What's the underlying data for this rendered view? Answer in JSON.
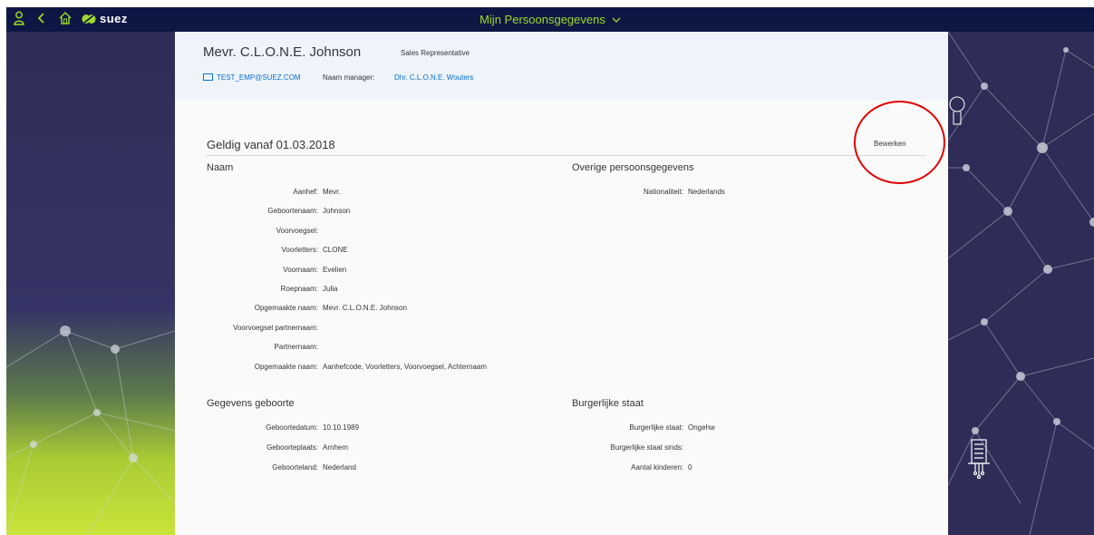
{
  "topbar": {
    "brand": "suez",
    "title": "Mijn Persoonsgegevens",
    "icons": [
      "user-icon",
      "back-icon",
      "home-icon",
      "chevron-down-icon"
    ]
  },
  "employee": {
    "name": "Mevr. C.L.O.N.E. Johnson",
    "role": "Sales Representative",
    "email": "TEST_EMP@SUEZ.COM",
    "manager_label": "Naam manager:",
    "manager_value": "Dhr. C.L.O.N.E. Wouters"
  },
  "record": {
    "valid_from": "Geldig vanaf 01.03.2018",
    "edit_label": "Bewerken"
  },
  "naam": {
    "title": "Naam",
    "fields": [
      {
        "label": "Aanhef:",
        "value": "Mevr."
      },
      {
        "label": "Geboortenaam:",
        "value": "Johnson"
      },
      {
        "label": "Voorvoegsel:",
        "value": ""
      },
      {
        "label": "Voorletters:",
        "value": "CLONE"
      },
      {
        "label": "Voornaam:",
        "value": "Evelien"
      },
      {
        "label": "Roepnaam:",
        "value": "Julia"
      },
      {
        "label": "Opgemaakte naam:",
        "value": "Mevr. C.L.O.N.E. Johnson"
      },
      {
        "label": "Voorvoegsel partnernaam:",
        "value": ""
      },
      {
        "label": "Partnernaam:",
        "value": ""
      },
      {
        "label": "Opgemaakte naam:",
        "value": "Aanhefcode, Voorletters, Voorvoegsel, Achternaam"
      }
    ]
  },
  "overige": {
    "title": "Overige persoonsgegevens",
    "fields": [
      {
        "label": "Nationaliteit:",
        "value": "Nederlands"
      }
    ]
  },
  "geboorte": {
    "title": "Gegevens geboorte",
    "fields": [
      {
        "label": "Geboortedatum:",
        "value": "10.10.1989"
      },
      {
        "label": "Geboorteplaats:",
        "value": "Arnhem"
      },
      {
        "label": "Geboorteland:",
        "value": "Nederland"
      }
    ]
  },
  "burgerlijk": {
    "title": "Burgerlijke staat",
    "fields": [
      {
        "label": "Burgerlijke staat:",
        "value": "Ongehw"
      },
      {
        "label": "Burgerlijke staat sinds:",
        "value": ""
      },
      {
        "label": "Aantal kinderen:",
        "value": "0"
      }
    ]
  },
  "colors": {
    "topbar": "#0e1744",
    "accent_green": "#9ed92a",
    "link_blue": "#0a6ed1",
    "highlight_red": "#e00000"
  }
}
